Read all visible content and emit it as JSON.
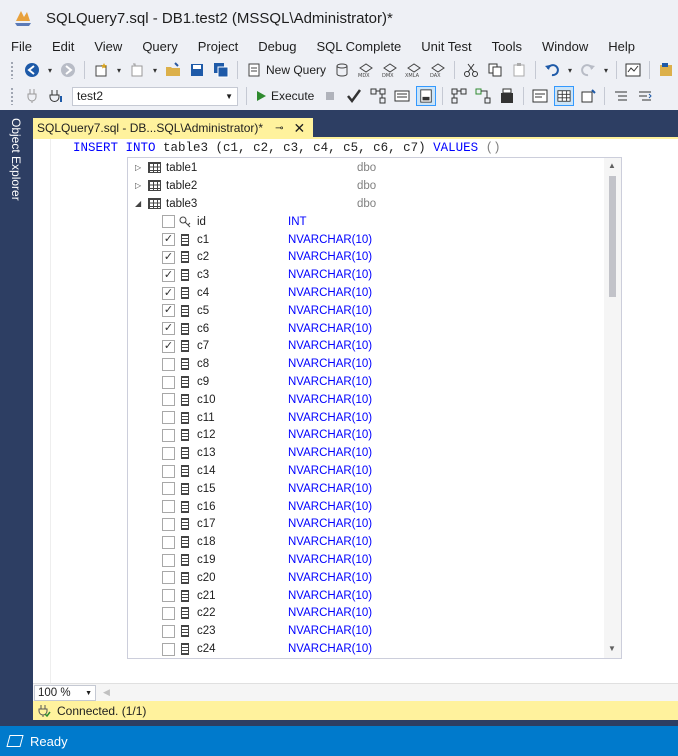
{
  "window": {
    "title": "SQLQuery7.sql - DB1.test2 (MSSQL\\Administrator)*"
  },
  "menu": [
    "File",
    "Edit",
    "View",
    "Query",
    "Project",
    "Debug",
    "SQL Complete",
    "Unit Test",
    "Tools",
    "Window",
    "Help"
  ],
  "toolbar1": {
    "new_query_label": "New Query"
  },
  "toolbar2": {
    "database": "test2",
    "execute_label": "Execute"
  },
  "side_panel": {
    "label": "Object Explorer"
  },
  "doc_tab": {
    "title": "SQLQuery7.sql - DB...SQL\\Administrator)*"
  },
  "editor": {
    "code": {
      "kw1": "INSERT",
      "kw2": "INTO",
      "table_cols": " table3 (c1, c2, c3, c4, c5, c6, c7) ",
      "kw3": "VALUES",
      "tail": " ()"
    }
  },
  "intellisense": {
    "tables": [
      {
        "name": "table1",
        "schema": "dbo",
        "expanded": false
      },
      {
        "name": "table2",
        "schema": "dbo",
        "expanded": false
      },
      {
        "name": "table3",
        "schema": "dbo",
        "expanded": true
      }
    ],
    "columns": [
      {
        "name": "id",
        "type": "INT",
        "key": true,
        "checked": false
      },
      {
        "name": "c1",
        "type": "NVARCHAR(10)",
        "checked": true
      },
      {
        "name": "c2",
        "type": "NVARCHAR(10)",
        "checked": true
      },
      {
        "name": "c3",
        "type": "NVARCHAR(10)",
        "checked": true
      },
      {
        "name": "c4",
        "type": "NVARCHAR(10)",
        "checked": true
      },
      {
        "name": "c5",
        "type": "NVARCHAR(10)",
        "checked": true
      },
      {
        "name": "c6",
        "type": "NVARCHAR(10)",
        "checked": true
      },
      {
        "name": "c7",
        "type": "NVARCHAR(10)",
        "checked": true
      },
      {
        "name": "c8",
        "type": "NVARCHAR(10)",
        "checked": false
      },
      {
        "name": "c9",
        "type": "NVARCHAR(10)",
        "checked": false
      },
      {
        "name": "c10",
        "type": "NVARCHAR(10)",
        "checked": false
      },
      {
        "name": "c11",
        "type": "NVARCHAR(10)",
        "checked": false
      },
      {
        "name": "c12",
        "type": "NVARCHAR(10)",
        "checked": false
      },
      {
        "name": "c13",
        "type": "NVARCHAR(10)",
        "checked": false
      },
      {
        "name": "c14",
        "type": "NVARCHAR(10)",
        "checked": false
      },
      {
        "name": "c15",
        "type": "NVARCHAR(10)",
        "checked": false
      },
      {
        "name": "c16",
        "type": "NVARCHAR(10)",
        "checked": false
      },
      {
        "name": "c17",
        "type": "NVARCHAR(10)",
        "checked": false
      },
      {
        "name": "c18",
        "type": "NVARCHAR(10)",
        "checked": false
      },
      {
        "name": "c19",
        "type": "NVARCHAR(10)",
        "checked": false
      },
      {
        "name": "c20",
        "type": "NVARCHAR(10)",
        "checked": false
      },
      {
        "name": "c21",
        "type": "NVARCHAR(10)",
        "checked": false
      },
      {
        "name": "c22",
        "type": "NVARCHAR(10)",
        "checked": false
      },
      {
        "name": "c23",
        "type": "NVARCHAR(10)",
        "checked": false
      },
      {
        "name": "c24",
        "type": "NVARCHAR(10)",
        "checked": false
      }
    ]
  },
  "zoom": {
    "value": "100 %"
  },
  "connection": {
    "status": "Connected. (1/1)"
  },
  "statusbar": {
    "text": "Ready"
  },
  "colors": {
    "accent": "#007acc",
    "tab_yellow": "#fff29d",
    "frame": "#2d3e63",
    "keyword": "#0000ff"
  }
}
